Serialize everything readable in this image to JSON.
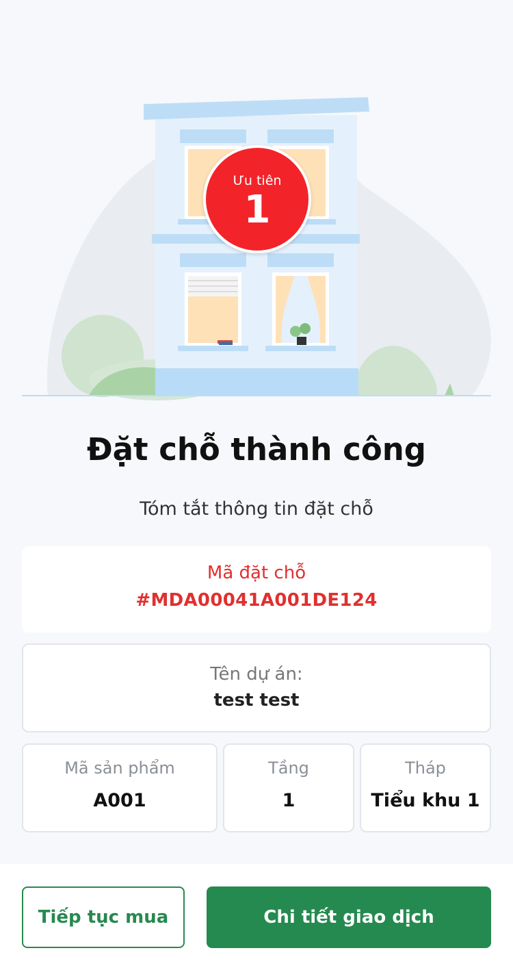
{
  "badge": {
    "label": "Ưu tiên",
    "number": "1"
  },
  "title": "Đặt chỗ thành công",
  "subtitle": "Tóm tắt thông tin đặt chỗ",
  "booking": {
    "label": "Mã đặt chỗ",
    "code": "#MDA00041A001DE124"
  },
  "project": {
    "label": "Tên dự án:",
    "name": "test test"
  },
  "details": [
    {
      "label": "Mã sản phẩm",
      "value": "A001"
    },
    {
      "label": "Tầng",
      "value": "1"
    },
    {
      "label": "Tháp",
      "value": "Tiểu khu 1"
    }
  ],
  "actions": {
    "continue_label": "Tiếp tục mua",
    "detail_label": "Chi tiết giao dịch"
  },
  "colors": {
    "accent_green": "#258a4f",
    "badge_red": "#f3232a",
    "code_red": "#e0302f"
  }
}
